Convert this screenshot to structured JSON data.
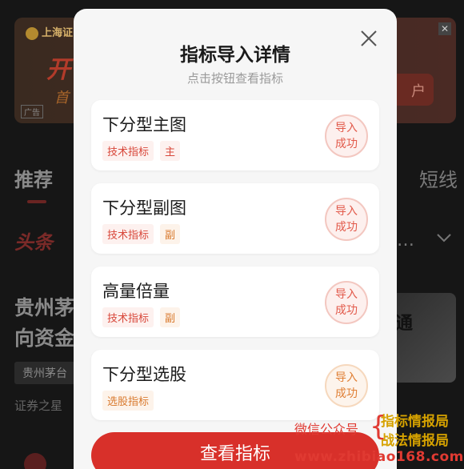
{
  "background": {
    "ad": {
      "logo_text": "上海证",
      "headline": "开",
      "subline": "首",
      "tag": "广告",
      "button_label": "户",
      "close_glyph": "✕"
    },
    "tabs": {
      "recommend": "推荐",
      "short": "短线"
    },
    "feed_header": {
      "brand": "头条",
      "ellipsis": "…"
    },
    "news": {
      "title_line1": "贵州茅",
      "title_line2": "向资金",
      "tag": "贵州茅台",
      "source": "证券之星",
      "image_text": "通"
    }
  },
  "modal": {
    "title": "指标导入详情",
    "subtitle": "点击按钮查看指标",
    "close_icon": "close-icon",
    "items": [
      {
        "name": "下分型主图",
        "tags": [
          "技术指标",
          "主"
        ],
        "status_line1": "导入",
        "status_line2": "成功"
      },
      {
        "name": "下分型副图",
        "tags": [
          "技术指标",
          "副"
        ],
        "status_line1": "导入",
        "status_line2": "成功"
      },
      {
        "name": "高量倍量",
        "tags": [
          "技术指标",
          "副"
        ],
        "status_line1": "导入",
        "status_line2": "成功"
      },
      {
        "name": "下分型选股",
        "tags": [
          "选股指标"
        ],
        "status_line1": "导入",
        "status_line2": "成功"
      }
    ],
    "view_button": "查看指标"
  },
  "watermark": {
    "left": "微信公众号",
    "right_line1": "指标情报局",
    "right_line2": "战法情报局",
    "url": "www.zhibiao168.com"
  },
  "colors": {
    "accent_red": "#d8302a",
    "tag_red": "#d8473a",
    "tag_orange": "#d97a2e",
    "watermark_gold": "#d6a200"
  }
}
